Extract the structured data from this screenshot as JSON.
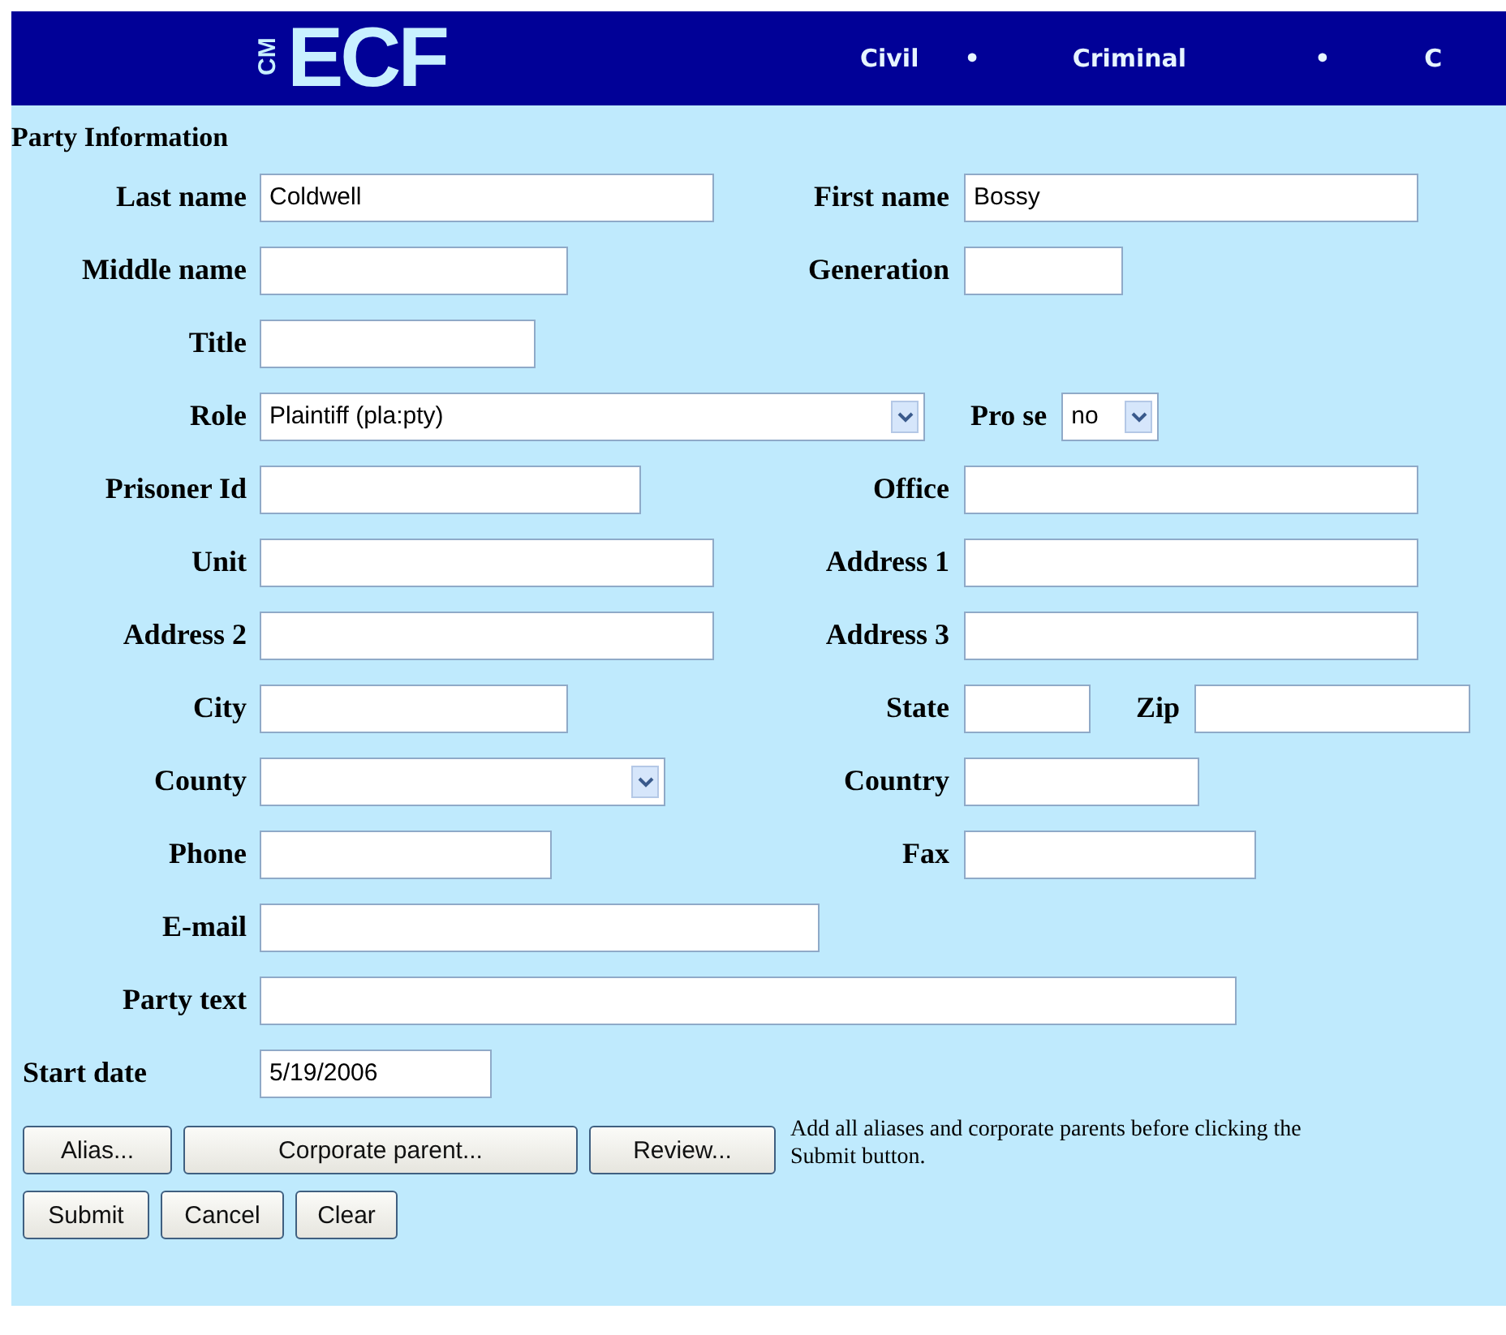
{
  "header": {
    "logo_small": "CM",
    "logo": "ECF",
    "nav": [
      {
        "label": "Civil"
      },
      {
        "label": "Criminal"
      },
      {
        "label": "C"
      }
    ],
    "separator": "•"
  },
  "section_title": "Party Information",
  "rows": [
    [
      {
        "label": "Last name",
        "value": "Coldwell",
        "kind": "text"
      },
      {
        "label": "First name",
        "value": "Bossy",
        "kind": "text"
      }
    ],
    [
      {
        "label": "Middle name",
        "kind": "text"
      },
      {
        "label": "Generation",
        "kind": "text"
      }
    ],
    [
      {
        "label": "Title",
        "kind": "text"
      }
    ],
    [
      {
        "label": "Role",
        "value": "Plaintiff (pla:pty)",
        "kind": "select"
      },
      {
        "label": "Pro se",
        "value": "no",
        "kind": "select"
      }
    ],
    [
      {
        "label": "Prisoner Id",
        "kind": "text"
      },
      {
        "label": "Office",
        "kind": "text"
      }
    ],
    [
      {
        "label": "Unit",
        "kind": "text"
      },
      {
        "label": "Address 1",
        "kind": "text"
      }
    ],
    [
      {
        "label": "Address 2",
        "kind": "text"
      },
      {
        "label": "Address 3",
        "kind": "text"
      }
    ],
    [
      {
        "label": "City",
        "kind": "text"
      },
      {
        "label": "State",
        "kind": "text"
      },
      {
        "label": "Zip",
        "kind": "text"
      }
    ],
    [
      {
        "label": "County",
        "kind": "select"
      },
      {
        "label": "Country",
        "kind": "text"
      }
    ],
    [
      {
        "label": "Phone",
        "kind": "text"
      },
      {
        "label": "Fax",
        "kind": "text"
      }
    ],
    [
      {
        "label": "E-mail",
        "kind": "text"
      }
    ],
    [
      {
        "label": "Party text",
        "kind": "text"
      }
    ]
  ],
  "start_date": {
    "label": "Start date",
    "value": "5/19/2006"
  },
  "buttons": [
    "Alias...",
    "Corporate parent...",
    "Review..."
  ],
  "note": "Add all aliases and corporate parents before clicking the Submit button.",
  "actions": [
    "Submit",
    "Cancel",
    "Clear"
  ]
}
